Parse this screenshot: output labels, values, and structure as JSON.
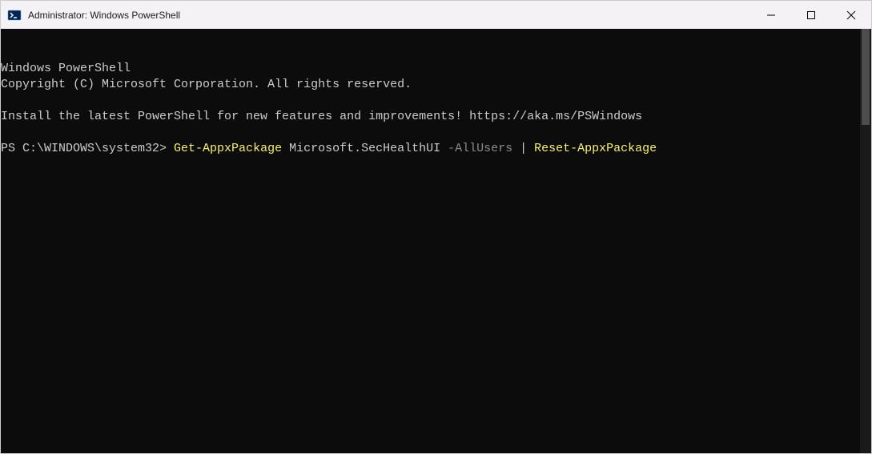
{
  "titlebar": {
    "title": "Administrator: Windows PowerShell"
  },
  "terminal": {
    "header_line1": "Windows PowerShell",
    "header_line2": "Copyright (C) Microsoft Corporation. All rights reserved.",
    "install_message": "Install the latest PowerShell for new features and improvements! https://aka.ms/PSWindows",
    "prompt": "PS C:\\WINDOWS\\system32> ",
    "command": {
      "cmdlet1": "Get-AppxPackage",
      "arg1": " Microsoft.SecHealthUI ",
      "param1": "-AllUsers",
      "pipe": " | ",
      "cmdlet2": "Reset-AppxPackage"
    }
  }
}
